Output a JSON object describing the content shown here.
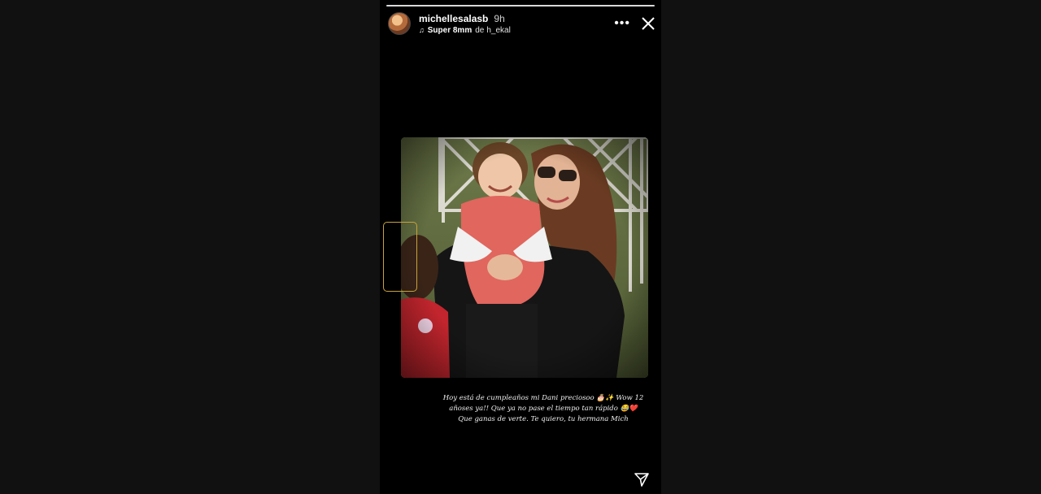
{
  "story": {
    "progress_segments": 1,
    "user": {
      "username": "michellesalasb",
      "time_ago": "9h"
    },
    "music": {
      "icon": "music-note-icon",
      "song": "Super 8mm",
      "artist_prefix": "de",
      "artist": "h_ekal"
    },
    "actions": {
      "more_icon": "more-options-icon",
      "more_glyph": "•••",
      "close_icon": "close-icon",
      "share_icon": "send-icon"
    },
    "caption": {
      "line1": "Hoy está de cumpleaños mi Dani preciosoo 🎂✨ Wow 12",
      "line2": "añoses ya!! Que ya no pase el tiempo tan rápido 😂❤️",
      "line3": "Que ganas de verte. Te quiero, tu hermana Mich"
    },
    "colors": {
      "frame_accent": "#c9a23a",
      "background": "#111112",
      "story_bg": "#000000"
    }
  }
}
